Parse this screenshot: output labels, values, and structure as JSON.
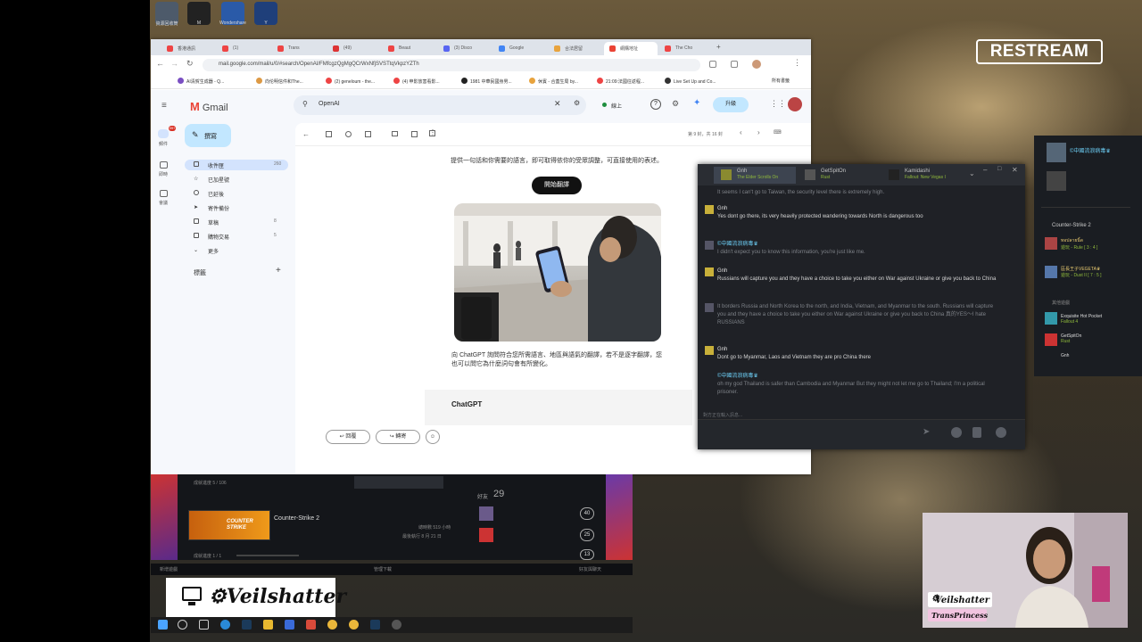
{
  "brand": {
    "restream": "RESTREAM",
    "streamer": "Veilshatter",
    "cam_tag": "Veilshatter",
    "cam_subtag": "TransPrincess"
  },
  "browser": {
    "url": "mail.google.com/mail/u/0/#search/OpenAI/FMfcgzQgMgQCrWxNfjSVSTtqVkpzYZTh",
    "tabs": [
      "香港通訊",
      "(1)",
      "Trans",
      "(49)",
      "Beaut",
      "(3) Disco",
      "Google",
      "合法居留",
      "網購地址",
      "The Cho"
    ],
    "bookmarks": [
      "AI清賀生成器 - Q...",
      "向伦明信件和The...",
      "(2) geneloum - the...",
      "(4) 申影放害看影...",
      "1981 中華民國身男...",
      "休賓 - 合蓋生局 by...",
      "21:09:法國往返程...",
      "Live Set Up and Co...",
      "所有書籤"
    ]
  },
  "gmail": {
    "logo": "Gmail",
    "search_value": "OpenAI",
    "status": "線上",
    "upgrade": "升級",
    "compose": "撰寫",
    "rail": [
      "郵件",
      "即時",
      "會議"
    ],
    "nav": [
      {
        "label": "收件匣",
        "count": "260"
      },
      {
        "label": "已加星號",
        "count": ""
      },
      {
        "label": "已延後",
        "count": ""
      },
      {
        "label": "寄件備份",
        "count": ""
      },
      {
        "label": "草稿",
        "count": "8"
      },
      {
        "label": "購物交易",
        "count": "5"
      },
      {
        "label": "更多",
        "count": ""
      }
    ],
    "labels_header": "標籤",
    "pager": "第 9 封，共 16 封",
    "body_text1": "提供一句話和你需要的語言，即可取得依你的受眾調整，可直接使用的表述。",
    "translate_button": "開始翻譯",
    "body_text2": "向 ChatGPT 詢問符合您所需語言、地區與語氣的翻譯，若不是逐字翻譯，您也可以問它為什麼詞句會有所變化。",
    "card_title": "ChatGPT",
    "reply": "回覆",
    "forward": "轉寄"
  },
  "chat": {
    "tabs": [
      {
        "name": "Gnh",
        "game": "The Elder Scrolls On"
      },
      {
        "name": "GetSpitOn",
        "game": "Rust"
      },
      {
        "name": "Kamidashi",
        "game": "Fallout: New Vegas I"
      }
    ],
    "messages": [
      {
        "author": "",
        "text": "It seems I can't go to Taiwan, the security level there is extremely high.",
        "dim": true
      },
      {
        "author": "Gnh",
        "text": "Yes dont go there, its very heavily protected wandering towards North is dangerous too",
        "dim": false
      },
      {
        "author": "©中國流浪病毒♛",
        "text": "I didn't expect you to know this information, you're just like me.",
        "dim": true
      },
      {
        "author": "Gnh",
        "text": "Russians will capture you and they have a choice to take you either on War against Ukraine or give you back to China",
        "dim": false
      },
      {
        "author": "©中國流浪病毒♛",
        "text": "It borders Russia and North Korea to the north, and India, Vietnam, and Myanmar to the south. Russians will capture you and they have a choice to take you either on War against Ukraine or give you back to China 真的YES～I hate RUSSIANS",
        "dim": true
      },
      {
        "author": "Gnh",
        "text": "Dont go to Myanmar, Laos and Vietnam they are pro China there",
        "dim": false
      },
      {
        "author": "©中國流浪病毒♛",
        "text": "oh my god Thailand is safer than Cambodia and Myanmar But they might not let me go to Thailand; I'm a political prisoner.",
        "dim": true
      }
    ],
    "input_placeholder": "對方正在輸入訊息..."
  },
  "friends": {
    "me": "©中國流浪病毒♛",
    "section_game": "Counter-Strike 2",
    "items": [
      {
        "name": "ทอปลายนิ้ด",
        "status": "遊玩 - Rule [ 3 : 4 ]"
      },
      {
        "name": "區長王子VEGETA♛",
        "status": "遊玩 - Dust II [ 7 : 5 ]"
      },
      {
        "name": "Exquisite Hot Pocket",
        "status": "Fallout 4"
      },
      {
        "name": "GetSpitOn",
        "status": "Rust"
      },
      {
        "name": "Gnh",
        "status": ""
      }
    ],
    "other_header": "其他遊戲"
  },
  "steam": {
    "playtime": "成就進度 5 / 106",
    "game": "Counter-Strike 2",
    "hours": "總時數 519 小時",
    "last": "最後執行 8 月 21 日",
    "progress2": "成就進度 1 / 1",
    "friends_label": "好友",
    "friends_count": "29",
    "counts": [
      "40",
      "25",
      "13"
    ],
    "add_game": "新增遊戲",
    "manage": "管理下載",
    "chat": "好友與聊天"
  },
  "taskbar_icons": [
    "windows-icon",
    "search-icon",
    "taskview-icon",
    "edge-icon",
    "steam-icon",
    "explorer-icon",
    "store-icon",
    "mail-icon",
    "chrome-icon",
    "chrome-icon",
    "steam-icon",
    "obs-icon"
  ]
}
